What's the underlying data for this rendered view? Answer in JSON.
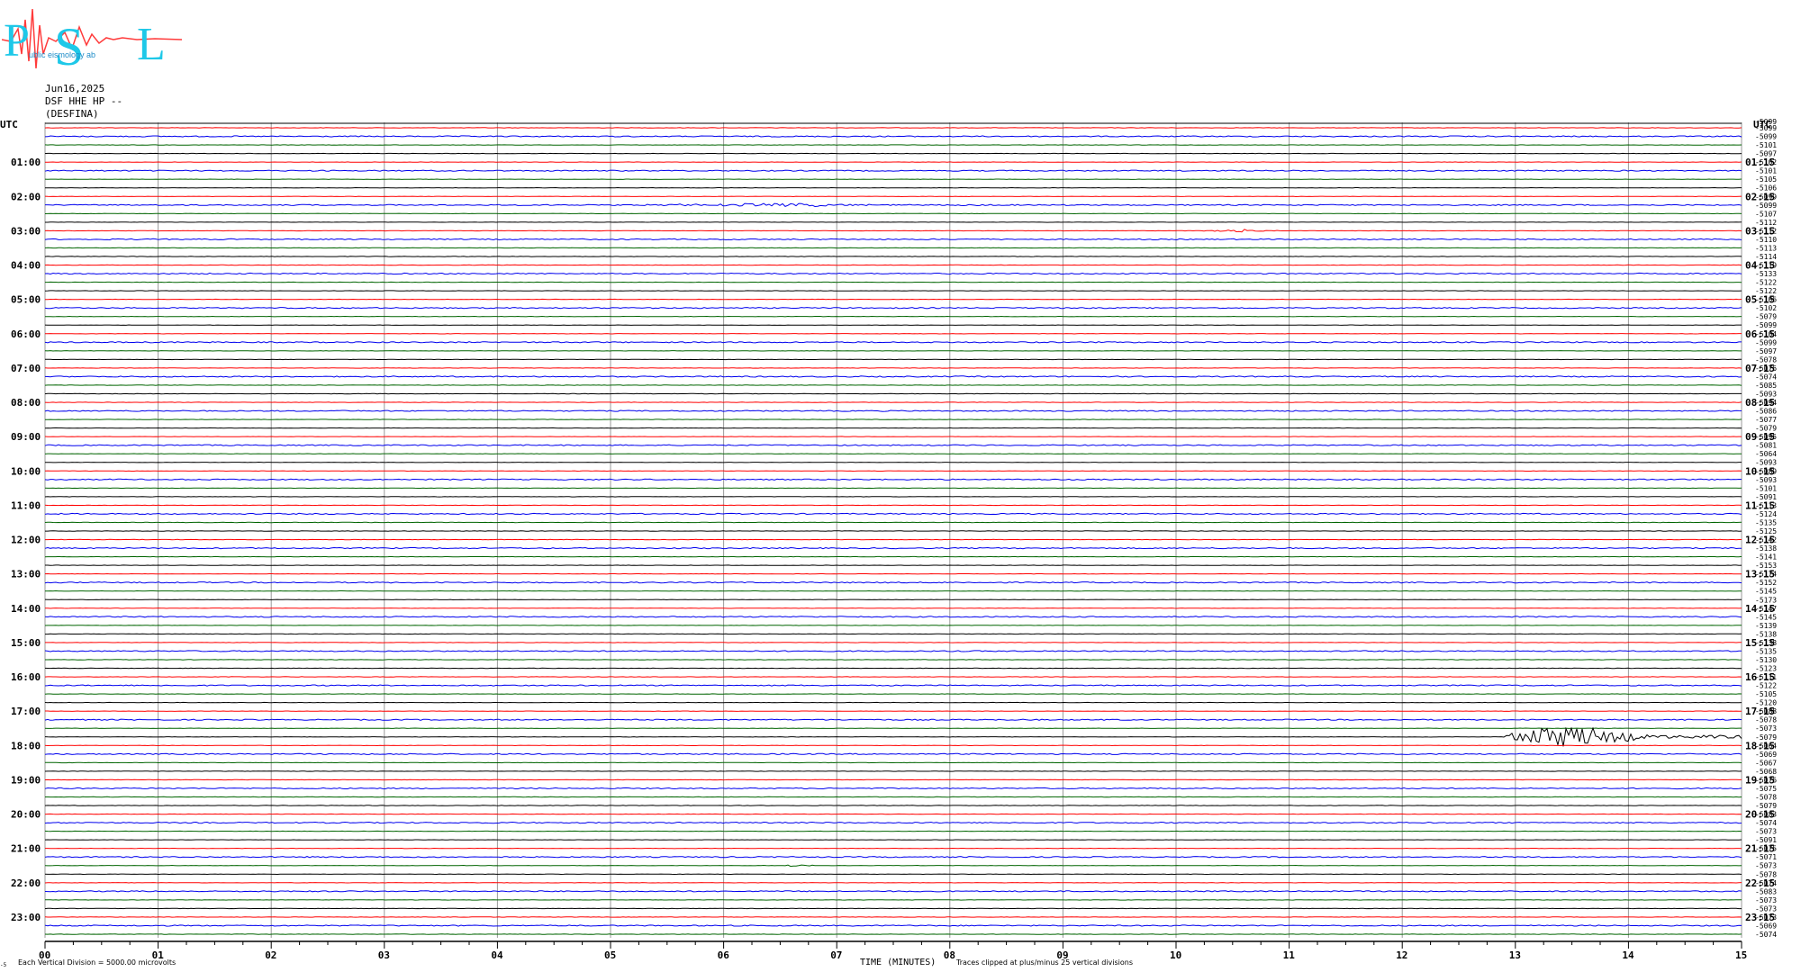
{
  "header": {
    "logo_text": {
      "p": "P",
      "s": "S",
      "l": "L",
      "small": "ublic  eismology  ab"
    },
    "date": "Jun16,2025",
    "channel": "DSF HHE HP --",
    "station": "(DESFINA)"
  },
  "chart_data": {
    "type": "line",
    "title": "",
    "xlabel": "TIME (MINUTES)",
    "ylabel": "",
    "xlim": [
      0,
      15
    ],
    "x_ticks": [
      "00",
      "01",
      "02",
      "03",
      "04",
      "05",
      "06",
      "07",
      "08",
      "09",
      "10",
      "11",
      "12",
      "13",
      "14",
      "15"
    ],
    "left_corner_label": "UTC",
    "right_corner_label": "UTC",
    "left_labels": [
      "01:00",
      "02:00",
      "03:00",
      "04:00",
      "05:00",
      "06:00",
      "07:00",
      "08:00",
      "09:00",
      "10:00",
      "11:00",
      "12:00",
      "13:00",
      "14:00",
      "15:00",
      "16:00",
      "17:00",
      "18:00",
      "19:00",
      "20:00",
      "21:00",
      "22:00",
      "23:00"
    ],
    "right_labels": [
      "01:15",
      "02:15",
      "03:15",
      "04:15",
      "05:15",
      "06:15",
      "07:15",
      "08:15",
      "09:15",
      "10:15",
      "11:15",
      "12:15",
      "13:15",
      "14:15",
      "15:15",
      "16:15",
      "17:15",
      "18:15",
      "19:15",
      "20:15",
      "21:15",
      "22:15",
      "23:15"
    ],
    "trace_offsets": [
      "-5099",
      "-5099",
      "-5101",
      "-5097",
      "-5102",
      "-5101",
      "-5105",
      "-5106",
      "-5099",
      "-5099",
      "-5107",
      "-5112",
      "-5112",
      "-5110",
      "-5113",
      "-5114",
      "-5119",
      "-5133",
      "-5122",
      "-5122",
      "-5106",
      "-5102",
      "-5079",
      "-5099",
      "-5104",
      "-5099",
      "-5097",
      "-5078",
      "-5076",
      "-5074",
      "-5085",
      "-5093",
      "-5094",
      "-5086",
      "-5077",
      "-5079",
      "-5095",
      "-5081",
      "-5064",
      "-5093",
      "-5089",
      "-5093",
      "-5101",
      "-5091",
      "-5113",
      "-5124",
      "-5135",
      "-5125",
      "-5142",
      "-5138",
      "-5141",
      "-5153",
      "-5174",
      "-5152",
      "-5145",
      "-5173",
      "-5147",
      "-5145",
      "-5139",
      "-5138",
      "-5138",
      "-5135",
      "-5130",
      "-5123",
      "-5111",
      "-5122",
      "-5105",
      "-5120",
      "-5088",
      "-5078",
      "-5073",
      "-5079",
      "-5064",
      "-5069",
      "-5067",
      "-5068",
      "-5076",
      "-5075",
      "-5078",
      "-5079",
      "-5083",
      "-5074",
      "-5073",
      "-5091",
      "-5075",
      "-5071",
      "-5073",
      "-5078",
      "-5074",
      "-5083",
      "-5073",
      "-5073",
      "-5073",
      "-5069",
      "-5074"
    ],
    "top_right_extra_label": "-5099",
    "trace_colors": [
      "#ff0000",
      "#0000ee",
      "#006400",
      "#000000"
    ],
    "events": [
      {
        "trace": 71,
        "start_min": 12.9,
        "end_min": 15.0,
        "peak_min": 13.5,
        "amplitude": 12
      },
      {
        "trace": 86,
        "start_min": 6.55,
        "end_min": 6.8,
        "peak_min": 6.62,
        "amplitude": 3
      },
      {
        "trace": 9,
        "start_min": 5.0,
        "end_min": 8.5,
        "peak_min": 6.5,
        "amplitude": 1.5
      },
      {
        "trace": 12,
        "start_min": 10.2,
        "end_min": 10.9,
        "peak_min": 10.55,
        "amplitude": 2
      }
    ],
    "grid": true
  },
  "footer": {
    "left_note": "Each Vertical Division = 5000.00 microvolts",
    "right_note": "Traces clipped at plus/minus 25 vertical divisions",
    "left_small": "-5"
  }
}
